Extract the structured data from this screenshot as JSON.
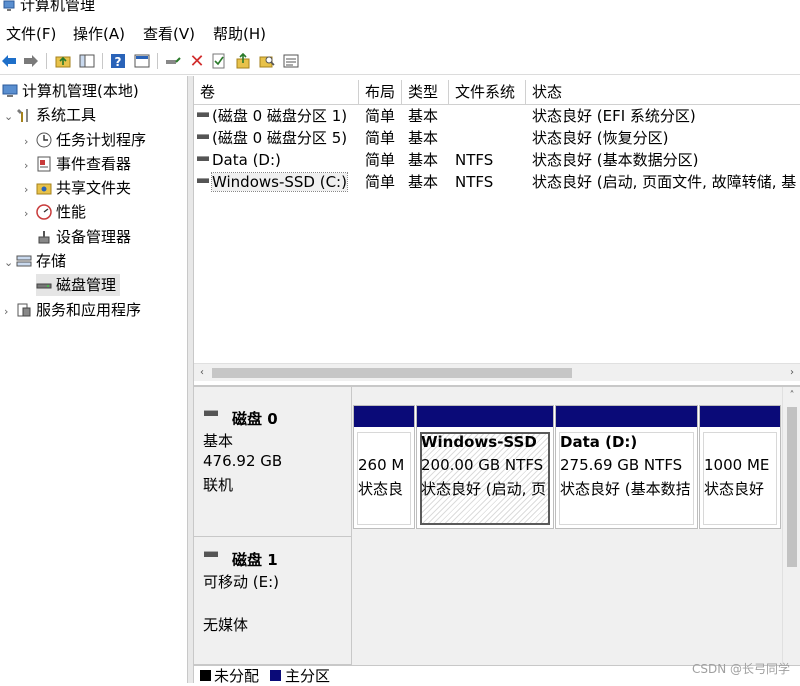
{
  "window": {
    "title": "计算机管理"
  },
  "menu": [
    "文件(F)",
    "操作(A)",
    "查看(V)",
    "帮助(H)"
  ],
  "toolbar": {
    "icons": [
      "back-arrow-icon",
      "forward-arrow-icon",
      "up-folder-icon",
      "show-hide-tree-icon",
      "help-icon",
      "console-view-icon",
      "connect-icon",
      "delete-icon",
      "properties-icon",
      "import-icon",
      "search-icon",
      "details-icon"
    ],
    "colors": {
      "delete": "#d12c2c",
      "nav": "#1e6fc9"
    }
  },
  "tree": {
    "root": "计算机管理(本地)",
    "system_tools": "系统工具",
    "task_scheduler": "任务计划程序",
    "event_viewer": "事件查看器",
    "shared_folders": "共享文件夹",
    "performance": "性能",
    "device_manager": "设备管理器",
    "storage": "存储",
    "disk_management": "磁盘管理",
    "services_apps": "服务和应用程序"
  },
  "volumes": {
    "columns": [
      "卷",
      "布局",
      "类型",
      "文件系统",
      "状态"
    ],
    "rows": [
      [
        "(磁盘 0 磁盘分区 1)",
        "简单",
        "基本",
        "",
        "状态良好 (EFI 系统分区)"
      ],
      [
        "(磁盘 0 磁盘分区 5)",
        "简单",
        "基本",
        "",
        "状态良好 (恢复分区)"
      ],
      [
        "Data (D:)",
        "简单",
        "基本",
        "NTFS",
        "状态良好 (基本数据分区)"
      ],
      [
        "Windows-SSD (C:)",
        "简单",
        "基本",
        "NTFS",
        "状态良好 (启动, 页面文件, 故障转储, 基"
      ]
    ]
  },
  "disks": [
    {
      "name": "磁盘 0",
      "type": "基本",
      "size": "476.92 GB",
      "status": "联机",
      "partitions": [
        {
          "title": "",
          "size": "260 M",
          "status": "状态良"
        },
        {
          "title": "Windows-SSD",
          "size": "200.00 GB NTFS",
          "status": "状态良好 (启动, 页"
        },
        {
          "title": "Data  (D:)",
          "size": "275.69 GB NTFS",
          "status": "状态良好 (基本数拮"
        },
        {
          "title": "",
          "size": "1000 ME",
          "status": "状态良好"
        }
      ]
    },
    {
      "name": "磁盘 1",
      "type": "可移动 (E:)",
      "media": "无媒体"
    }
  ],
  "legend": [
    {
      "label": "未分配",
      "color": "#000000"
    },
    {
      "label": "主分区",
      "color": "#0a0a78"
    }
  ],
  "watermark": "CSDN @长弓同学"
}
